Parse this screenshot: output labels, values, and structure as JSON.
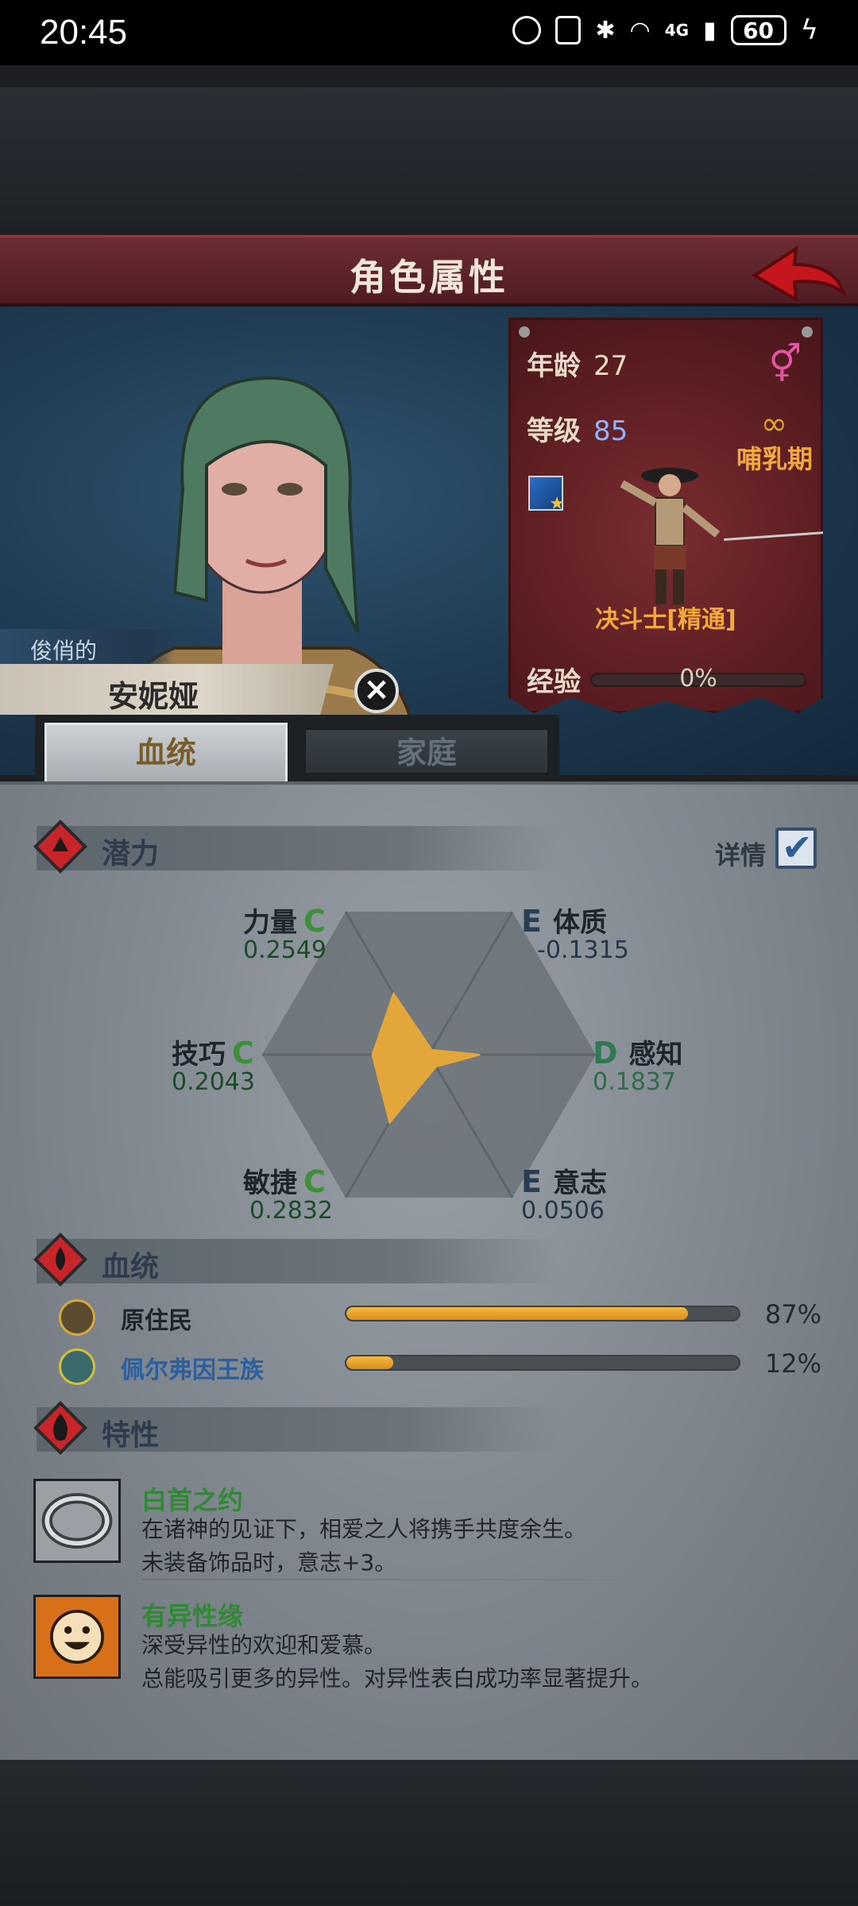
{
  "status_bar": {
    "time": "20:45",
    "network": "4G",
    "battery": "60"
  },
  "header": {
    "title": "角色属性"
  },
  "character": {
    "nickname": "俊俏的",
    "name": "安妮娅"
  },
  "info": {
    "age_label": "年龄",
    "age": "27",
    "level_label": "等级",
    "level": "85",
    "stage": "哺乳期",
    "class_name": "决斗士[精通]",
    "exp_label": "经验",
    "exp_percent": "0%",
    "exp_value": 0
  },
  "tabs": {
    "bloodline": "血统",
    "family": "家庭"
  },
  "potential": {
    "title": "潜力",
    "detail_label": "详情",
    "stats": [
      {
        "name": "力量",
        "grade": "C",
        "value": "0.2549"
      },
      {
        "name": "体质",
        "grade": "E",
        "value": "-0.1315"
      },
      {
        "name": "技巧",
        "grade": "C",
        "value": "0.2043"
      },
      {
        "name": "感知",
        "grade": "D",
        "value": "0.1837"
      },
      {
        "name": "敏捷",
        "grade": "C",
        "value": "0.2832"
      },
      {
        "name": "意志",
        "grade": "E",
        "value": "0.0506"
      }
    ]
  },
  "bloodline": {
    "title": "血统",
    "items": [
      {
        "name": "原住民",
        "percent": "87%",
        "value": 0.87
      },
      {
        "name": "佩尔弗因王族",
        "percent": "12%",
        "value": 0.12
      }
    ]
  },
  "traits": {
    "title": "特性",
    "items": [
      {
        "name": "白首之约",
        "desc1": "在诸神的见证下，相爱之人将携手共度余生。",
        "desc2": "未装备饰品时，意志+3。"
      },
      {
        "name": "有异性缘",
        "desc1": "深受异性的欢迎和爱慕。",
        "desc2": "总能吸引更多的异性。对异性表白成功率显著提升。"
      }
    ]
  },
  "colors": {
    "grade_c": "#3f8f3a",
    "grade_d": "#2f7a55",
    "grade_e": "#2a3e52",
    "bar_fill": "#f0a82e",
    "trait_name": "#2f8a33"
  },
  "icons": [
    "female-icon",
    "rings-icon",
    "close-icon",
    "back-arrow-icon",
    "checkbox-icon",
    "potential-icon",
    "bloodline-icon",
    "trait-icon",
    "ring-icon",
    "smiley-icon"
  ]
}
